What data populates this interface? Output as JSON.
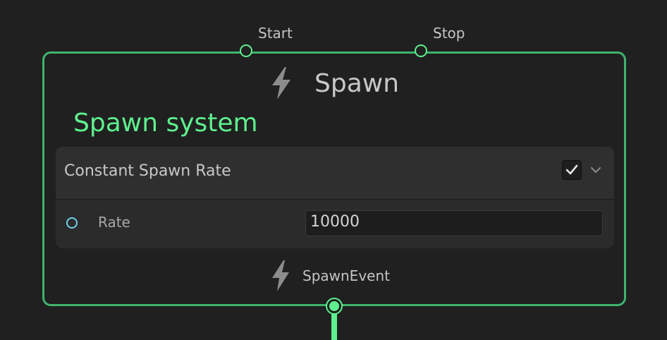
{
  "ports": {
    "start_label": "Start",
    "stop_label": "Stop"
  },
  "node": {
    "title": "Spawn",
    "title_icon": "lightning-bolt-icon",
    "subtitle": "Spawn system",
    "block": {
      "title": "Constant Spawn Rate",
      "enabled": true,
      "expand_icon": "chevron-down-icon",
      "property": {
        "label": "Rate",
        "value": "10000"
      }
    },
    "event": {
      "icon": "lightning-bolt-icon",
      "label": "SpawnEvent"
    }
  },
  "colors": {
    "background": "#202020",
    "accent_green": "#5ef08f",
    "node_border": "#3fb46e",
    "slot_cyan": "#6fd0e8"
  }
}
